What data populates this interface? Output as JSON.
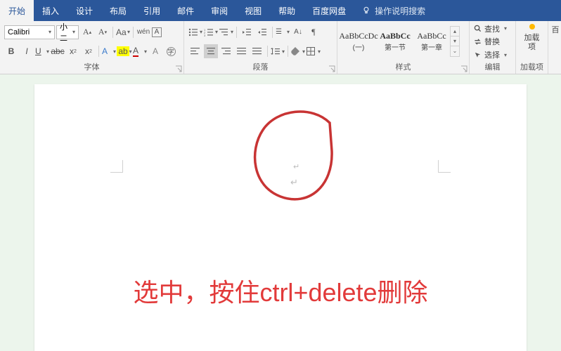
{
  "menu": {
    "tabs": [
      "开始",
      "插入",
      "设计",
      "布局",
      "引用",
      "邮件",
      "审阅",
      "视图",
      "帮助",
      "百度网盘"
    ],
    "activeIndex": 0,
    "opSearch": "操作说明搜索"
  },
  "ribbon": {
    "font": {
      "name": "Calibri",
      "size": "小二",
      "groupLabel": "字体"
    },
    "para": {
      "groupLabel": "段落"
    },
    "styles": {
      "groupLabel": "样式",
      "items": [
        {
          "sample": "AaBbCcDc",
          "label": "(一)"
        },
        {
          "sample": "AaBbCc",
          "label": "第一节"
        },
        {
          "sample": "AaBbCc",
          "label": "第一章"
        }
      ]
    },
    "edit": {
      "groupLabel": "编辑",
      "find": "查找",
      "replace": "替换",
      "select": "选择"
    },
    "addins": {
      "groupLabel": "加载项",
      "label": "加载项"
    },
    "extra": {
      "label": "百"
    }
  },
  "annot": {
    "text": "选中，按住ctrl+delete删除",
    "marks": {
      "m1": "↵",
      "m2": "↵"
    }
  }
}
